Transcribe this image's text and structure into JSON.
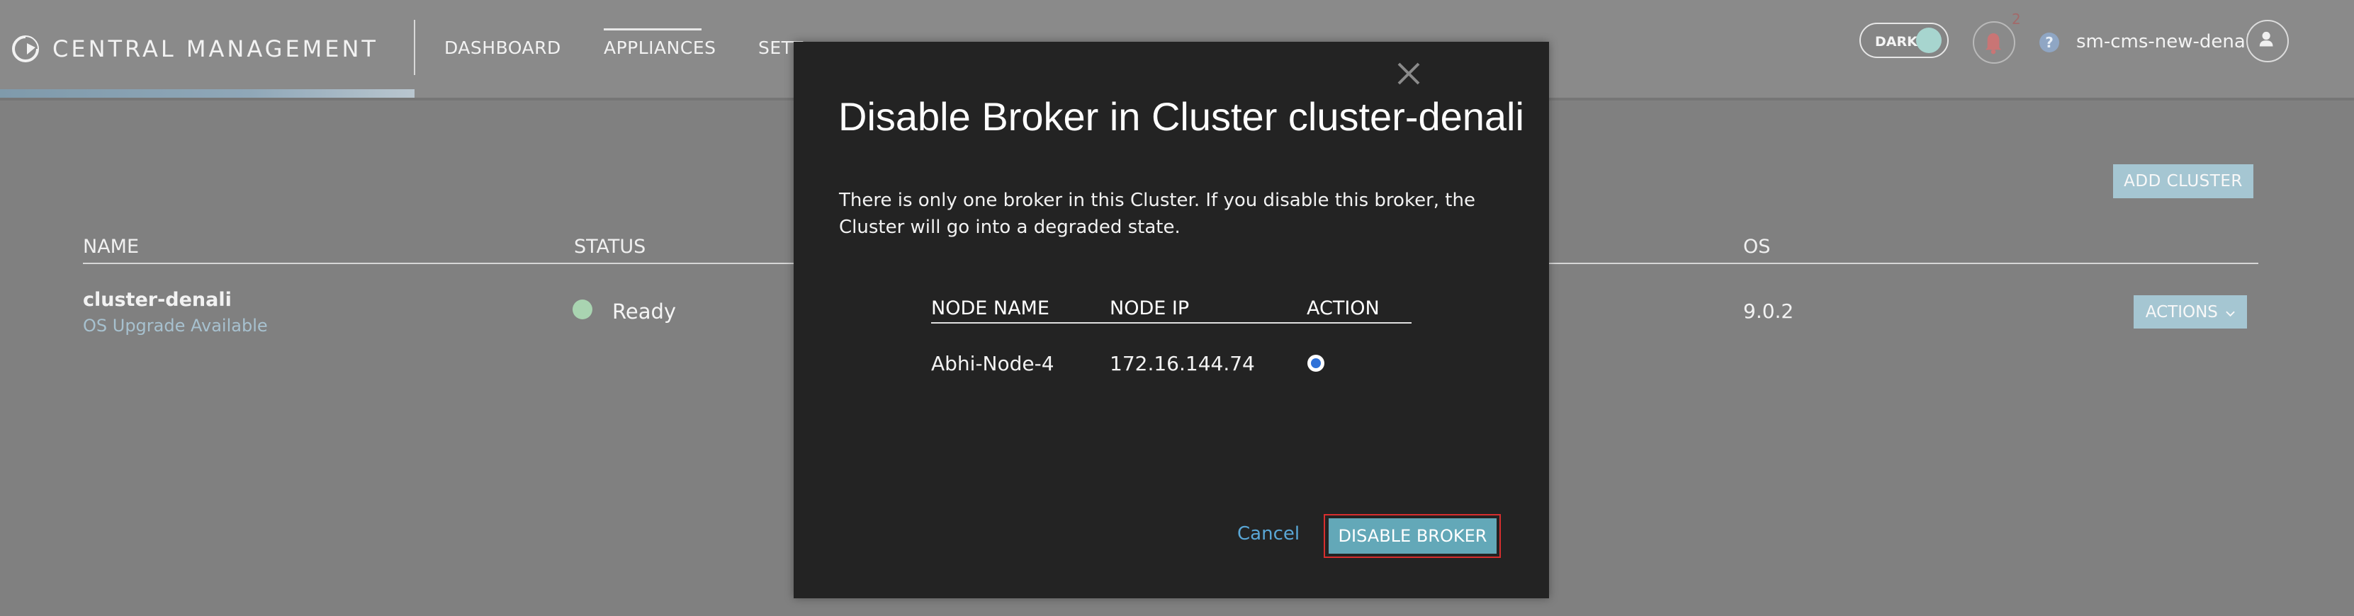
{
  "header": {
    "brand": "CENTRAL MANAGEMENT",
    "nav": [
      "DASHBOARD",
      "APPLIANCES",
      "SETT"
    ],
    "active_nav_index": 1,
    "dark_toggle_label": "DARK",
    "notification_count": "2",
    "help_symbol": "?",
    "username": "sm-cms-new-denali"
  },
  "cluster_page": {
    "add_cluster_label": "ADD CLUSTER",
    "columns": {
      "name": "NAME",
      "status": "STATUS",
      "os": "OS"
    },
    "rows": [
      {
        "name": "cluster-denali",
        "subtitle": "OS Upgrade Available",
        "status": "Ready",
        "os": "9.0.2",
        "actions_label": "ACTIONS"
      }
    ]
  },
  "modal": {
    "title": "Disable Broker in Cluster cluster-denali",
    "message": "There is only one broker in this Cluster. If you disable this broker, the Cluster will go into a degraded state.",
    "table_headers": [
      "NODE NAME",
      "NODE IP",
      "ACTION"
    ],
    "nodes": [
      {
        "node_name": "Abhi-Node-4",
        "node_ip": "172.16.144.74",
        "selected": true
      }
    ],
    "cancel_label": "Cancel",
    "confirm_label": "DISABLE BROKER"
  },
  "icons": {
    "brand": "brand-logo-icon",
    "bell": "bell-icon",
    "help": "help-icon",
    "avatar": "user-avatar-icon",
    "close": "close-icon",
    "chevron": "chevron-down-icon"
  },
  "colors": {
    "status_ready": "#a9d4b1",
    "primary_button": "#63a8b8",
    "danger_outline": "#d82e2e",
    "link": "#5aa7d6"
  }
}
